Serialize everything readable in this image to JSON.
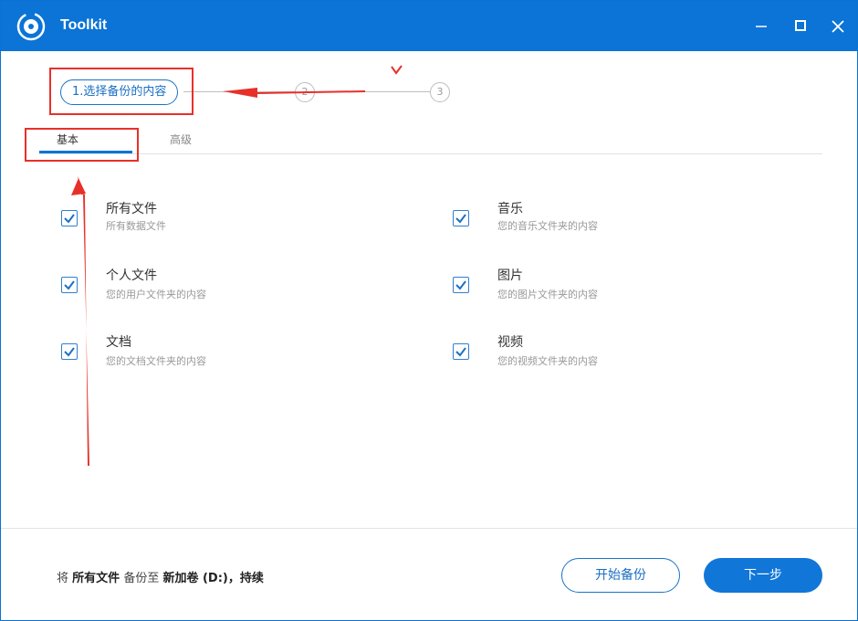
{
  "window": {
    "title": "Toolkit",
    "accent_color": "#0b74d6",
    "icons": [
      "app-logo-icon",
      "minimize-icon",
      "maximize-icon",
      "close-icon"
    ]
  },
  "steps": {
    "current_label": "1.选择备份的内容",
    "step2_label": "2",
    "step3_label": "3"
  },
  "tabs": {
    "basic": "基本",
    "advanced": "高级",
    "active": "basic"
  },
  "options": [
    {
      "title": "所有文件",
      "desc": "所有数据文件",
      "checked": true
    },
    {
      "title": "音乐",
      "desc": "您的音乐文件夹的内容",
      "checked": true
    },
    {
      "title": "个人文件",
      "desc": "您的用户文件夹的内容",
      "checked": true
    },
    {
      "title": "图片",
      "desc": "您的图片文件夹的内容",
      "checked": true
    },
    {
      "title": "文档",
      "desc": "您的文档文件夹的内容",
      "checked": true
    },
    {
      "title": "视频",
      "desc": "您的视频文件夹的内容",
      "checked": true
    }
  ],
  "footer": {
    "summary_prefix": "将",
    "summary_source": "所有文件",
    "summary_middle": "备份至",
    "summary_target": "新加卷 (D:)",
    "summary_suffix": "，持续",
    "start_button": "开始备份",
    "next_button": "下一步"
  },
  "annotations": {
    "color": "#e8302a"
  }
}
